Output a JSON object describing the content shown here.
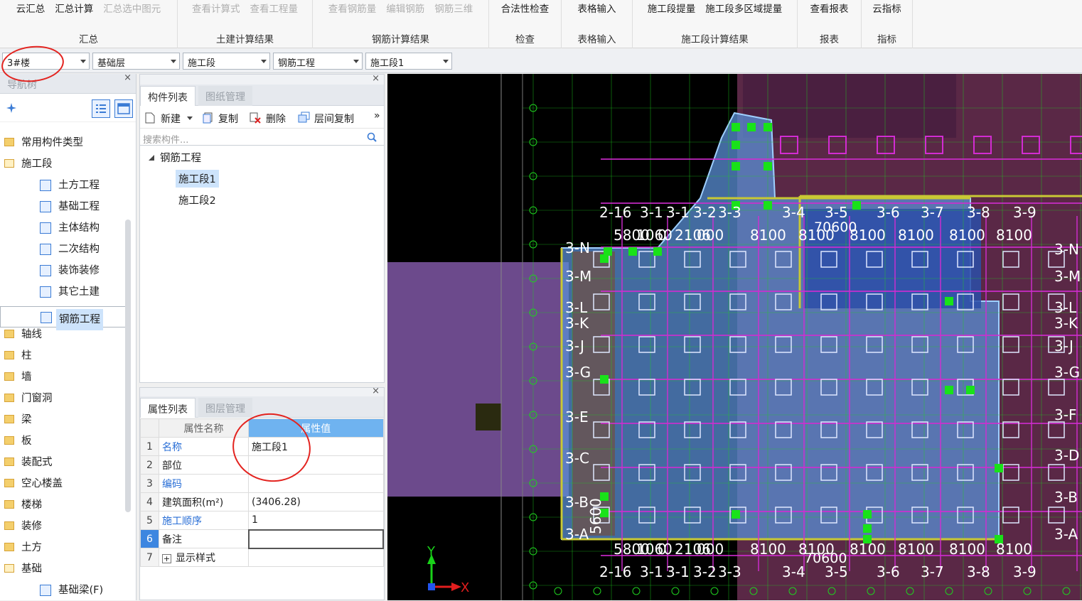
{
  "ribbon": {
    "groups": [
      {
        "label": "汇总",
        "buttons": [
          "云汇总",
          "汇总计算",
          "汇总选中图元"
        ]
      },
      {
        "label": "土建计算结果",
        "buttons": [
          "查看计算式",
          "查看工程量"
        ]
      },
      {
        "label": "钢筋计算结果",
        "buttons": [
          "查看钢筋量",
          "编辑钢筋",
          "钢筋三维"
        ]
      },
      {
        "label": "检查",
        "buttons": [
          "合法性检查"
        ]
      },
      {
        "label": "表格输入",
        "buttons": [
          "表格输入"
        ]
      },
      {
        "label": "施工段计算结果",
        "buttons": [
          "施工段提量",
          "施工段多区域提量"
        ]
      },
      {
        "label": "报表",
        "buttons": [
          "查看报表"
        ]
      },
      {
        "label": "指标",
        "buttons": [
          "云指标"
        ]
      }
    ]
  },
  "selectors": [
    "3#楼",
    "基础层",
    "施工段",
    "钢筋工程",
    "施工段1"
  ],
  "nav": {
    "title": "导航树",
    "close": "×",
    "items": [
      {
        "label": "常用构件类型",
        "level": 0
      },
      {
        "label": "施工段",
        "level": 0
      },
      {
        "label": "土方工程",
        "level": 1
      },
      {
        "label": "基础工程",
        "level": 1
      },
      {
        "label": "主体结构",
        "level": 1
      },
      {
        "label": "二次结构",
        "level": 1
      },
      {
        "label": "装饰装修",
        "level": 1
      },
      {
        "label": "其它土建",
        "level": 1
      },
      {
        "label": "钢筋工程",
        "level": 1
      },
      {
        "label": "轴线",
        "level": 0
      },
      {
        "label": "柱",
        "level": 0
      },
      {
        "label": "墙",
        "level": 0
      },
      {
        "label": "门窗洞",
        "level": 0
      },
      {
        "label": "梁",
        "level": 0
      },
      {
        "label": "板",
        "level": 0
      },
      {
        "label": "装配式",
        "level": 0
      },
      {
        "label": "空心楼盖",
        "level": 0
      },
      {
        "label": "楼梯",
        "level": 0
      },
      {
        "label": "装修",
        "level": 0
      },
      {
        "label": "土方",
        "level": 0
      },
      {
        "label": "基础",
        "level": 0
      },
      {
        "label": "基础梁(F)",
        "level": 1
      }
    ]
  },
  "component_panel": {
    "close": "×",
    "tabs": [
      "构件列表",
      "图纸管理"
    ],
    "toolbar": [
      "新建",
      "复制",
      "删除",
      "层间复制"
    ],
    "more": "»",
    "search_placeholder": "搜索构件...",
    "tree_root": "钢筋工程",
    "tree_items": [
      "施工段1",
      "施工段2"
    ]
  },
  "props_panel": {
    "close": "×",
    "tabs": [
      "属性列表",
      "图层管理"
    ],
    "header_name": "属性名称",
    "header_value": "属性值",
    "rows": [
      {
        "no": "1",
        "name": "名称",
        "value": "施工段1",
        "blue": true
      },
      {
        "no": "2",
        "name": "部位",
        "value": "",
        "blue": false
      },
      {
        "no": "3",
        "name": "编码",
        "value": "",
        "blue": true
      },
      {
        "no": "4",
        "name": "建筑面积(m²)",
        "value": "(3406.28)",
        "blue": false
      },
      {
        "no": "5",
        "name": "施工顺序",
        "value": "1",
        "blue": true
      },
      {
        "no": "6",
        "name": "备注",
        "value": "",
        "blue": false
      },
      {
        "no": "7",
        "name": "显示样式",
        "value": "",
        "blue": false
      }
    ],
    "expand": "+"
  },
  "canvas": {
    "axis_top": [
      "2-16",
      "3-1",
      "3-1",
      "3-2",
      "3-3",
      "3-4",
      "3-5",
      "3-6",
      "3-7",
      "3-8",
      "3-9"
    ],
    "dims_top": [
      "5800",
      "1060",
      "0",
      "2106",
      "000",
      "8100",
      "8100",
      "8100",
      "8100",
      "8100",
      "8100"
    ],
    "dims_top_total": "70600",
    "dims_bottom": [
      "5800",
      "1060",
      "0",
      "2106",
      "000",
      "8100",
      "8100",
      "8100",
      "8100",
      "8100",
      "8100"
    ],
    "dims_bottom_total": "70600",
    "axis_bottom": [
      "2-16",
      "3-1",
      "3-1",
      "3-2",
      "3-3",
      "3-4",
      "3-5",
      "3-6",
      "3-7",
      "3-8",
      "3-9"
    ],
    "axis_left": [
      "3-N",
      "3-M",
      "3-L",
      "3-K",
      "3-J",
      "3-G",
      "3-E",
      "3-C",
      "3-B",
      "3-A"
    ],
    "axis_right": [
      "3-N",
      "3-M",
      "3-L",
      "3-K",
      "3-J",
      "3-G",
      "3-F",
      "3-D",
      "3-B",
      "3-A"
    ],
    "left_dim": "5600",
    "x_label": "X",
    "y_label": "Y",
    "colors": {
      "plate": "#5a8fd6",
      "wall": "#c8c834",
      "beam": "#d22cd2",
      "grid": "#1fd11f",
      "purple": "#6c4a8c"
    }
  }
}
